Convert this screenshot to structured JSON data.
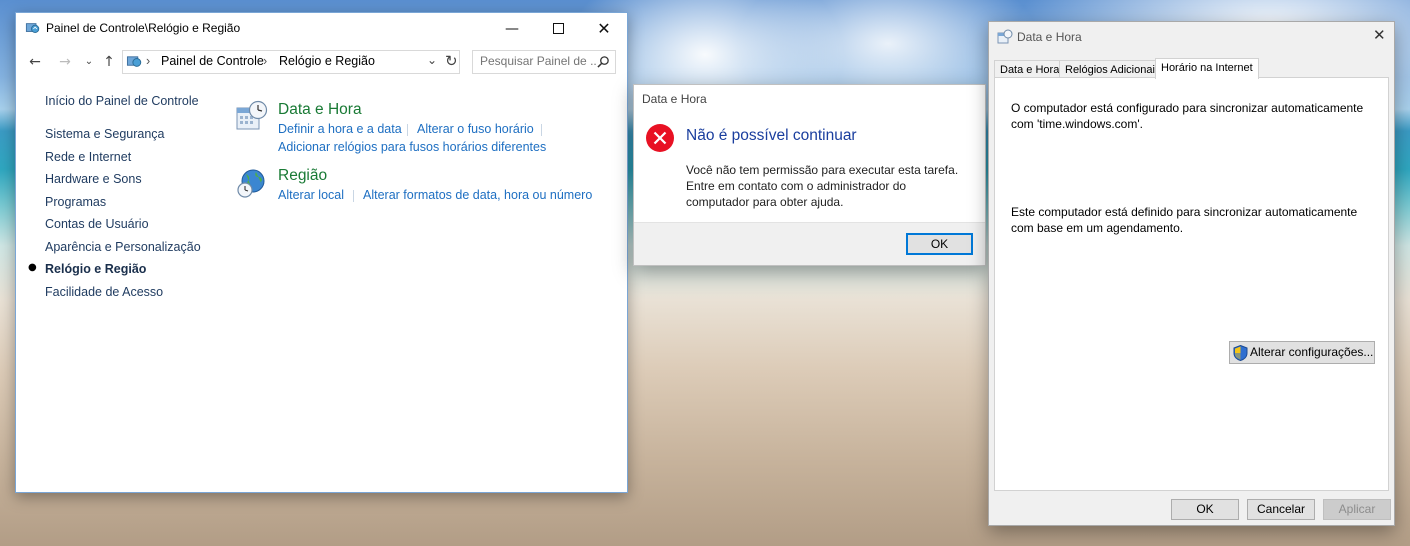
{
  "control_panel": {
    "window_title": "Painel de Controle\\Relógio e Região",
    "breadcrumb": [
      "Painel de Controle",
      "Relógio e Região"
    ],
    "search_placeholder": "Pesquisar Painel de ...",
    "sidebar": [
      {
        "label": "Início do Painel de Controle",
        "current": false
      },
      {
        "label": "Sistema e Segurança",
        "current": false
      },
      {
        "label": "Rede e Internet",
        "current": false
      },
      {
        "label": "Hardware e Sons",
        "current": false
      },
      {
        "label": "Programas",
        "current": false
      },
      {
        "label": "Contas de Usuário",
        "current": false
      },
      {
        "label": "Aparência e Personalização",
        "current": false
      },
      {
        "label": "Relógio e Região",
        "current": true
      },
      {
        "label": "Facilidade de Acesso",
        "current": false
      }
    ],
    "sections": [
      {
        "title": "Data e Hora",
        "icon": "calendar-clock-icon",
        "links": [
          "Definir a hora e a data",
          "Alterar o fuso horário",
          "Adicionar relógios para fusos horários diferentes"
        ]
      },
      {
        "title": "Região",
        "icon": "globe-clock-icon",
        "links": [
          "Alterar local",
          "Alterar formatos de data, hora ou número"
        ]
      }
    ]
  },
  "error_dialog": {
    "title": "Data e Hora",
    "heading": "Não é possível continuar",
    "message": "Você não tem permissão para executar esta tarefa. Entre em contato com o administrador do computador para obter ajuda.",
    "ok_label": "OK",
    "icon": "error-icon"
  },
  "datetime_dialog": {
    "title": "Data e Hora",
    "tabs": [
      {
        "label": "Data e Hora",
        "active": false
      },
      {
        "label": "Relógios Adicionais",
        "active": false
      },
      {
        "label": "Horário na Internet",
        "active": true
      }
    ],
    "sync_text": "O computador está configurado para sincronizar automaticamente com 'time.windows.com'.",
    "schedule_text": "Este computador está definido para sincronizar automaticamente com base em um agendamento.",
    "change_button": "Alterar configurações...",
    "ok_label": "OK",
    "cancel_label": "Cancelar",
    "apply_label": "Aplicar"
  },
  "colors": {
    "link": "#1e6fc2",
    "section_title": "#197a35",
    "error_red": "#e81123",
    "dialog_heading": "#1a3e9e"
  }
}
